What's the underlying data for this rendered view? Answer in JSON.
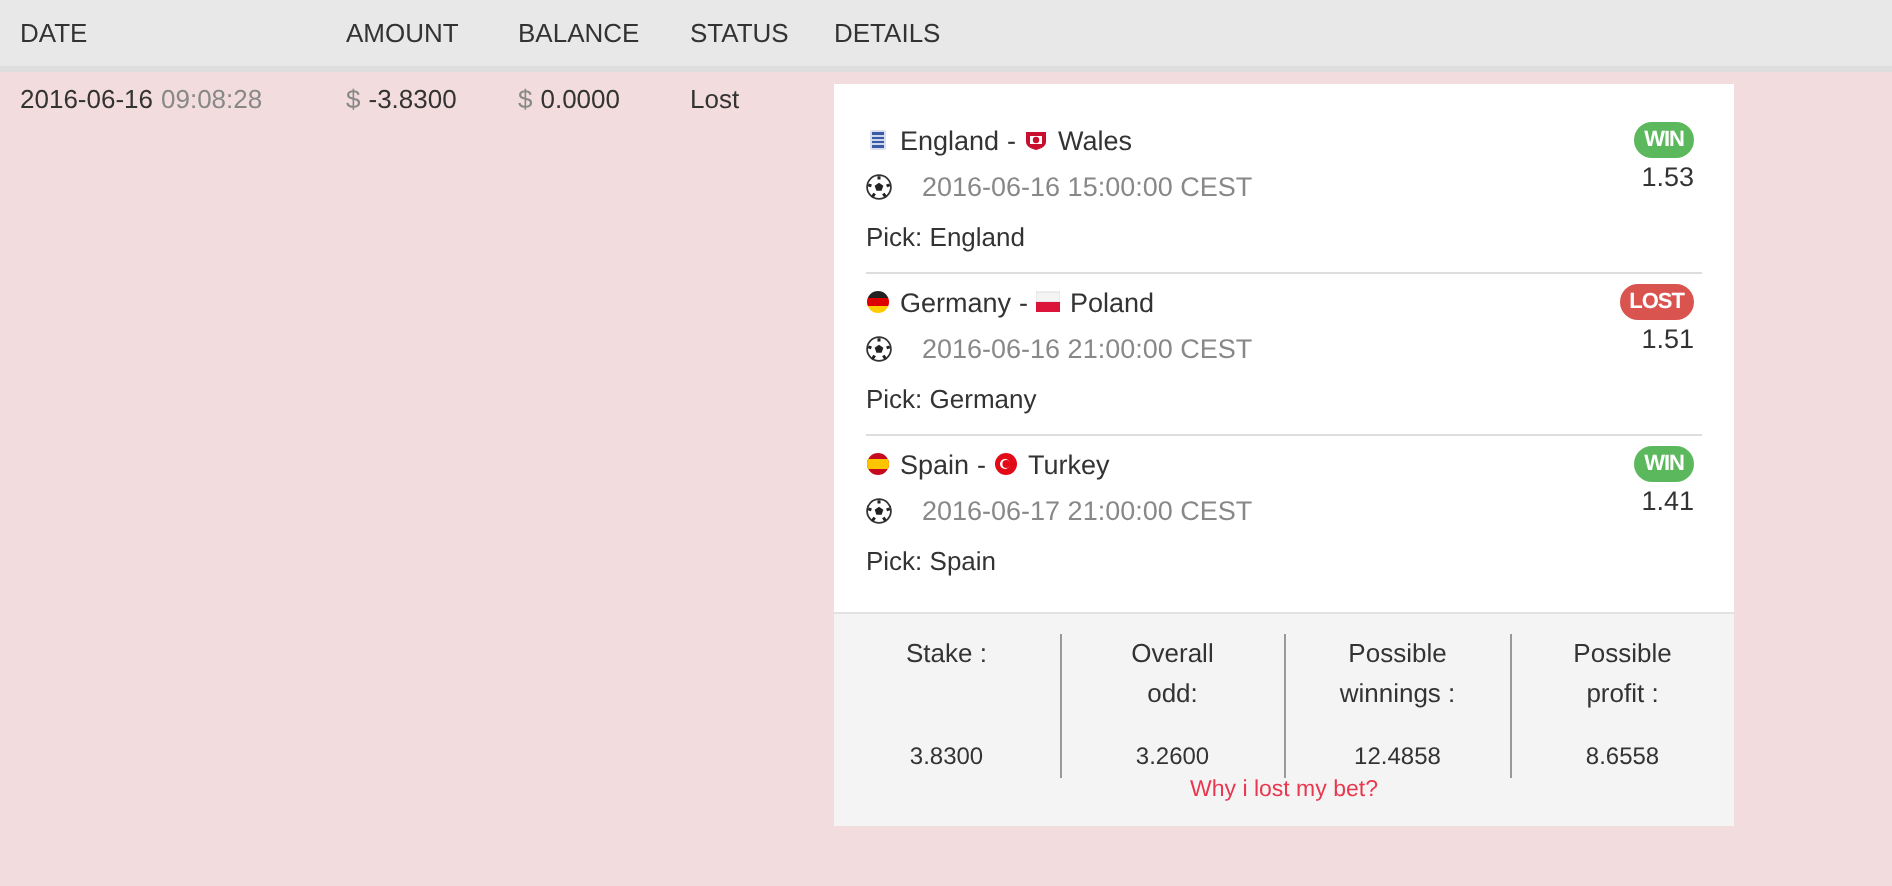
{
  "table": {
    "columns": [
      "DATE",
      "AMOUNT",
      "BALANCE",
      "STATUS",
      "DETAILS"
    ],
    "rows": [
      {
        "date": "2016-06-16",
        "time": "09:08:28",
        "currency": "$",
        "amount": "-3.8300",
        "balance": "0.0000",
        "status": "Lost",
        "lost": true,
        "details": {
          "bets": [
            {
              "home": {
                "name": "England",
                "kind": "england"
              },
              "separator": "-",
              "away": {
                "name": "Wales",
                "kind": "wales"
              },
              "datetime": "2016-06-16 15:00:00 CEST",
              "pick": "Pick: England",
              "result": "WIN",
              "won": true,
              "odd": "1.53"
            },
            {
              "home": {
                "name": "Germany",
                "kind": "germany"
              },
              "separator": "-",
              "away": {
                "name": "Poland",
                "kind": "poland"
              },
              "datetime": "2016-06-16 21:00:00 CEST",
              "pick": "Pick: Germany",
              "result": "LOST",
              "won": false,
              "odd": "1.51"
            },
            {
              "home": {
                "name": "Spain",
                "kind": "spain"
              },
              "separator": "-",
              "away": {
                "name": "Turkey",
                "kind": "turkey"
              },
              "datetime": "2016-06-17 21:00:00 CEST",
              "pick": "Pick: Spain",
              "result": "WIN",
              "won": true,
              "odd": "1.41"
            }
          ],
          "summary": [
            {
              "label": "Stake :",
              "value": "3.8300"
            },
            {
              "label": "Overall odd:",
              "value": "3.2600"
            },
            {
              "label": "Possible winnings :",
              "value": "12.4858"
            },
            {
              "label": "Possible profit :",
              "value": "8.6558"
            }
          ],
          "link": "Why i lost my bet?"
        }
      }
    ]
  }
}
